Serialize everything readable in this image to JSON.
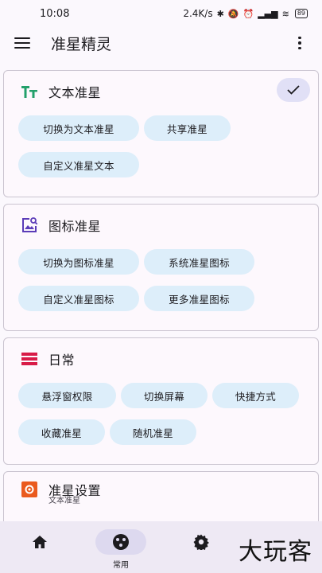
{
  "status": {
    "time": "10:08",
    "speed": "2.4K/s",
    "battery": "89"
  },
  "app": {
    "title": "准星精灵"
  },
  "cards": {
    "text": {
      "title": "文本准星",
      "chips": [
        "切换为文本准星",
        "共享准星",
        "自定义准星文本"
      ]
    },
    "icon": {
      "title": "图标准星",
      "chips": [
        "切换为图标准星",
        "系统准星图标",
        "自定义准星图标",
        "更多准星图标"
      ]
    },
    "daily": {
      "title": "日常",
      "chips": [
        "悬浮窗权限",
        "切换屏幕",
        "快捷方式",
        "收藏准星",
        "随机准星"
      ]
    },
    "settings": {
      "title": "准星设置",
      "subtitle": "文本准星"
    }
  },
  "nav": {
    "home_icon": "home-icon",
    "common_label": "常用",
    "settings_icon": "gear-icon"
  },
  "colors": {
    "text_icon": "#23a06b",
    "icon_icon": "#5b3cb8",
    "daily_icon": "#d81b47",
    "settings_icon": "#ea5a1e",
    "chip_bg": "#ddeefa"
  },
  "watermark": "大玩客"
}
